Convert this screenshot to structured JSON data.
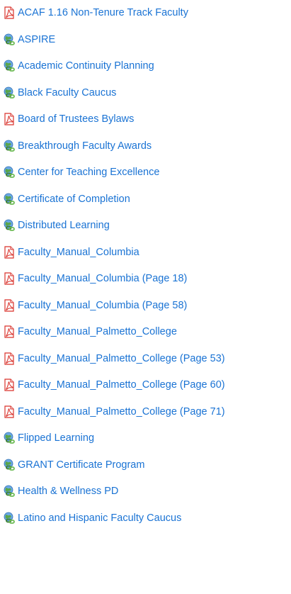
{
  "links": [
    {
      "label": "ACAF 1.16 Non-Tenure Track Faculty",
      "icon": "pdf-icon"
    },
    {
      "label": "ASPIRE",
      "icon": "web-link-icon"
    },
    {
      "label": "Academic Continuity Planning",
      "icon": "web-link-icon"
    },
    {
      "label": "Black Faculty Caucus",
      "icon": "web-link-icon"
    },
    {
      "label": "Board of Trustees Bylaws",
      "icon": "pdf-icon"
    },
    {
      "label": "Breakthrough Faculty Awards",
      "icon": "web-link-icon"
    },
    {
      "label": "Center for Teaching Excellence",
      "icon": "web-link-icon"
    },
    {
      "label": "Certificate of Completion",
      "icon": "web-link-icon"
    },
    {
      "label": "Distributed Learning",
      "icon": "web-link-icon"
    },
    {
      "label": "Faculty_Manual_Columbia",
      "icon": "pdf-icon"
    },
    {
      "label": "Faculty_Manual_Columbia (Page 18)",
      "icon": "pdf-icon"
    },
    {
      "label": "Faculty_Manual_Columbia (Page 58)",
      "icon": "pdf-icon"
    },
    {
      "label": "Faculty_Manual_Palmetto_College",
      "icon": "pdf-icon"
    },
    {
      "label": "Faculty_Manual_Palmetto_College (Page 53)",
      "icon": "pdf-icon"
    },
    {
      "label": "Faculty_Manual_Palmetto_College (Page 60)",
      "icon": "pdf-icon"
    },
    {
      "label": "Faculty_Manual_Palmetto_College (Page 71)",
      "icon": "pdf-icon"
    },
    {
      "label": "Flipped Learning",
      "icon": "web-link-icon"
    },
    {
      "label": "GRANT Certificate Program",
      "icon": "web-link-icon"
    },
    {
      "label": "Health & Wellness PD",
      "icon": "web-link-icon"
    },
    {
      "label": "Latino and Hispanic Faculty Caucus",
      "icon": "web-link-icon"
    }
  ],
  "colors": {
    "link": "#1a73d4",
    "pdf_icon": "#d9322b",
    "web_icon_globe": "#3f8fd8",
    "web_icon_chain": "#5aa64a"
  }
}
